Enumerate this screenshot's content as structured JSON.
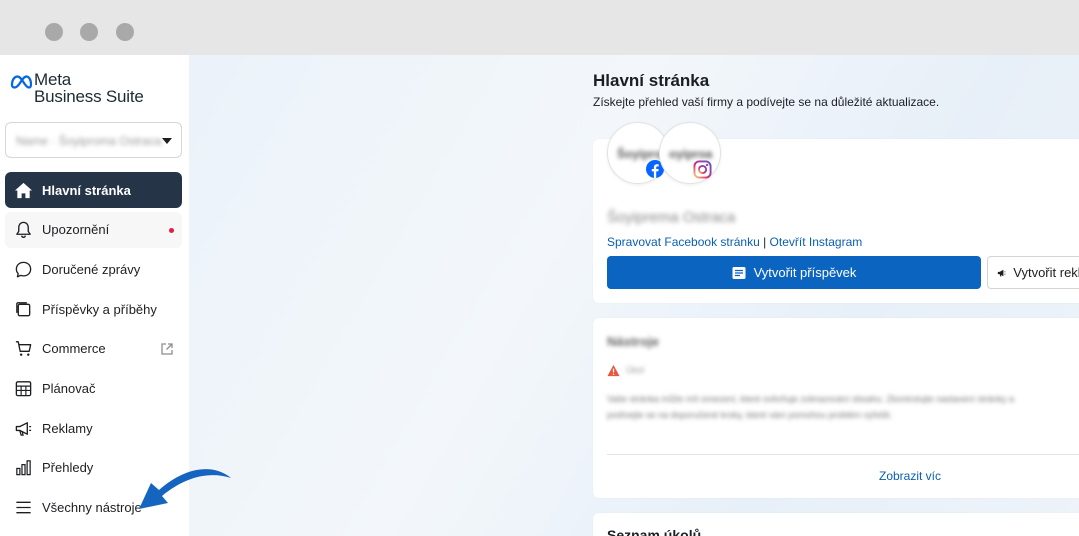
{
  "window": {
    "controls": [
      "close",
      "minimize",
      "maximize"
    ]
  },
  "sidebar": {
    "logo": {
      "line1": "Meta",
      "line2": "Business Suite",
      "icon": "meta-logo-icon"
    },
    "account": {
      "name": "Name · Šoyiproma Ostraca"
    },
    "items": [
      {
        "label": "Hlavní stránka",
        "icon": "home-icon",
        "active": true
      },
      {
        "label": "Upozornění",
        "icon": "bell-icon",
        "badge_dot": true
      },
      {
        "label": "Doručené zprávy",
        "icon": "chat-bubble-icon"
      },
      {
        "label": "Příspěvky a příběhy",
        "icon": "stories-icon"
      },
      {
        "label": "Commerce",
        "icon": "cart-icon",
        "external": true
      },
      {
        "label": "Plánovač",
        "icon": "calendar-icon"
      },
      {
        "label": "Reklamy",
        "icon": "megaphone-icon"
      },
      {
        "label": "Přehledy",
        "icon": "bar-chart-icon"
      },
      {
        "label": "Všechny nástroje",
        "icon": "menu-icon"
      }
    ]
  },
  "main": {
    "title": "Hlavní stránka",
    "subtitle": "Získejte přehled vaší firmy a podívejte se na důležité aktualizace.",
    "profile_card": {
      "fb_avatar_text": "Šoyiproa",
      "ig_avatar_text": "oyiproa",
      "page_name": "Šoyiprema Ostraca",
      "link_manage": "Spravovat Facebook stránku",
      "link_separator": " | ",
      "link_instagram": "Otevřít Instagram",
      "create_post_label": "Vytvořit příspěvek",
      "create_ad_label": "Vytvořit reklamu"
    },
    "notices_card": {
      "heading": "Nástroje",
      "warning_label": "Úkol",
      "body": "Vaše stránka může mít omezení, které ovlivňuje zobrazování obsahu. Zkontrolujte nastavení stránky a podívejte se na doporučené kroky, které vám pomohou problém vyřešit.",
      "show_more": "Zobrazit víc"
    },
    "tasks_card": {
      "heading": "Seznam úkolů"
    }
  },
  "colors": {
    "active_nav_bg": "#253446",
    "primary_button": "#0b64c0",
    "link": "#0a5fb0",
    "annotation_arrow": "#1565c0",
    "notification_dot": "#e41e3f"
  }
}
